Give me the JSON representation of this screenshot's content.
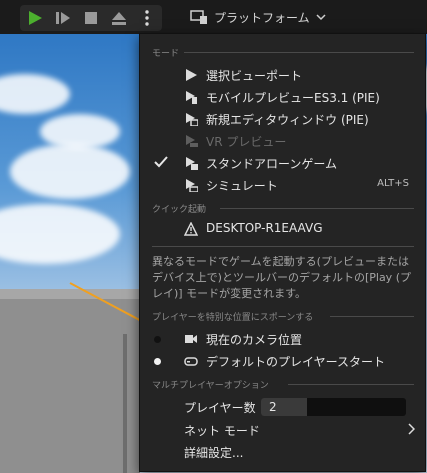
{
  "toolbar": {
    "platform_label": "プラットフォーム"
  },
  "menu": {
    "mode_header": "モード",
    "items": [
      {
        "label": "選択ビューポート"
      },
      {
        "label": "モバイルプレビューES3.1 (PIE)"
      },
      {
        "label": "新規エディタウィンドウ (PIE)"
      },
      {
        "label": "VR プレビュー"
      },
      {
        "label": "スタンドアローンゲーム"
      },
      {
        "label": "シミュレート",
        "shortcut": "ALT+S"
      }
    ],
    "quick_header": "クイック起動",
    "device": "DESKTOP-R1EAAVG",
    "description": "異なるモードでゲームを起動する(プレビューまたはデバイス上で)とツールバーのデフォルトの[Play (プレイ)] モードが変更されます。",
    "spawn_header": "プレイヤーを特別な位置にスポーンする",
    "spawn_items": [
      {
        "label": "現在のカメラ位置"
      },
      {
        "label": "デフォルトのプレイヤースタート"
      }
    ],
    "multi_header": "マルチプレイヤーオプション",
    "players_label": "プレイヤー数",
    "players_value": "2",
    "net_mode_label": "ネット モード",
    "advanced_label": "詳細設定..."
  },
  "colors": {
    "accent_green": "#4caf2e",
    "menu_bg": "#242424",
    "text": "#e6e6e6"
  }
}
